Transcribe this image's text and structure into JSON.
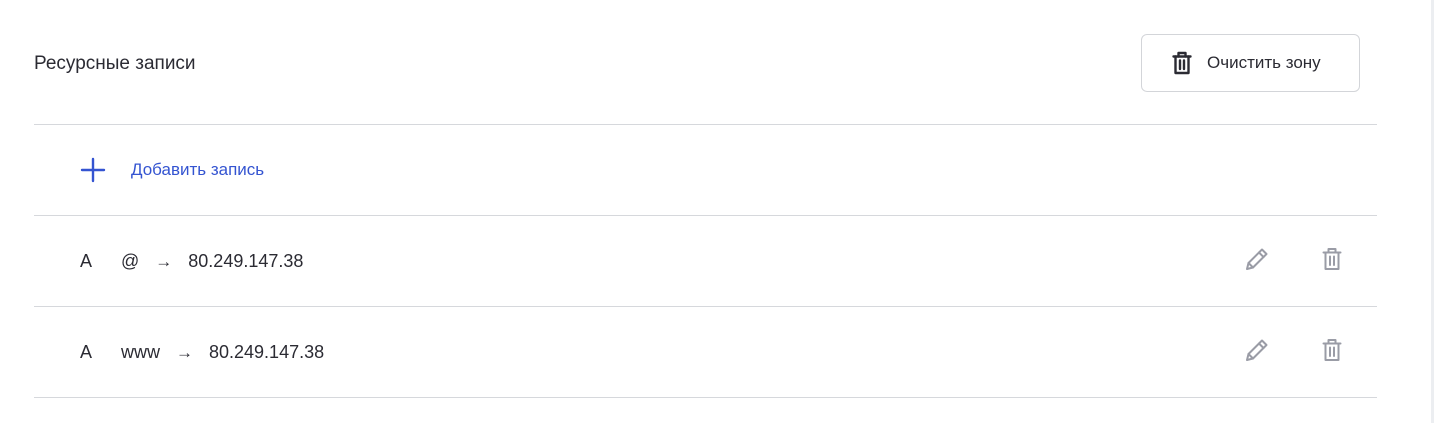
{
  "section": {
    "title": "Ресурсные записи",
    "clear_button": {
      "label": "Очистить зону",
      "icon": "trash-icon"
    }
  },
  "add_record": {
    "label": "Добавить запись",
    "icon": "plus-icon"
  },
  "records": [
    {
      "type": "A",
      "name": "@",
      "arrow": "→",
      "value": "80.249.147.38",
      "edit_icon": "pencil-icon",
      "delete_icon": "trash-icon"
    },
    {
      "type": "A",
      "name": "www",
      "arrow": "→",
      "value": "80.249.147.38",
      "edit_icon": "pencil-icon",
      "delete_icon": "trash-icon"
    }
  ],
  "colors": {
    "accent": "#3454d1",
    "text": "#2b2b33",
    "divider": "#d6d8dc",
    "muted_icon": "#9a9ca6"
  }
}
